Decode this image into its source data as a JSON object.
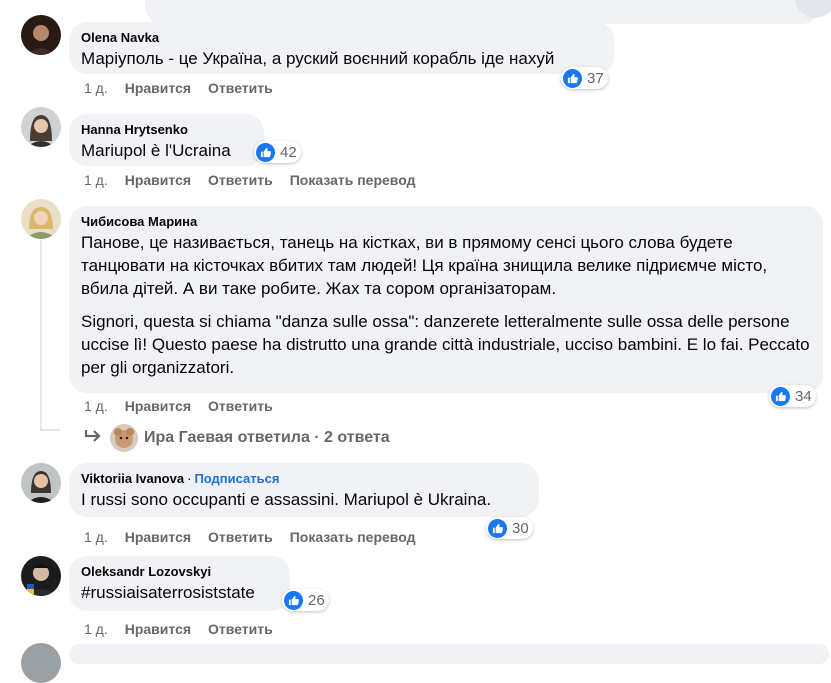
{
  "comments": [
    {
      "author": "Olena Navka",
      "text": [
        "Маріуполь - це Україна, а руский воєнний корабль іде нахуй"
      ],
      "likes": "37",
      "time": "1 д.",
      "like_label": "Нравится",
      "reply_label": "Ответить"
    },
    {
      "author": "Hanna Hrytsenko",
      "text": [
        "Mariupol è l'Ucraina"
      ],
      "likes": "42",
      "time": "1 д.",
      "like_label": "Нравится",
      "reply_label": "Ответить",
      "translate_label": "Показать перевод"
    },
    {
      "author": "Чибисова Марина",
      "text": [
        "Панове, це називається, танець на кістках, ви в прямому сенсі цього слова будете танцювати на кісточках вбитих там людей! Ця країна знищила велике підриємче місто, вбила дітей. А ви таке робите. Жах та сором організаторам.",
        "Signori, questa si chiama \"danza sulle ossa\": danzerete letteralmente sulle ossa delle persone uccise lì! Questo paese ha distrutto una grande città industriale, ucciso bambini. E lo fai. Peccato per gli organizzatori."
      ],
      "likes": "34",
      "time": "1 д.",
      "like_label": "Нравится",
      "reply_label": "Ответить",
      "replies_text": "Ира Гаевая ответила · 2 ответа"
    },
    {
      "author": "Viktoriia Ivanova",
      "follow_label": "Подписаться",
      "text": [
        "I russi sono occupanti e assassini. Mariupol è Ukraina."
      ],
      "likes": "30",
      "time": "1 д.",
      "like_label": "Нравится",
      "reply_label": "Ответить",
      "translate_label": "Показать перевод"
    },
    {
      "author": "Oleksandr Lozovskyi",
      "text": [
        "#russiaisaterrosiststate"
      ],
      "likes": "26",
      "time": "1 д.",
      "like_label": "Нравится",
      "reply_label": "Ответить"
    }
  ],
  "colors": {
    "bubble": "#f0f2f5",
    "like_blue": "#1877f2",
    "meta_grey": "#65676b",
    "link_blue": "#216fdb"
  }
}
